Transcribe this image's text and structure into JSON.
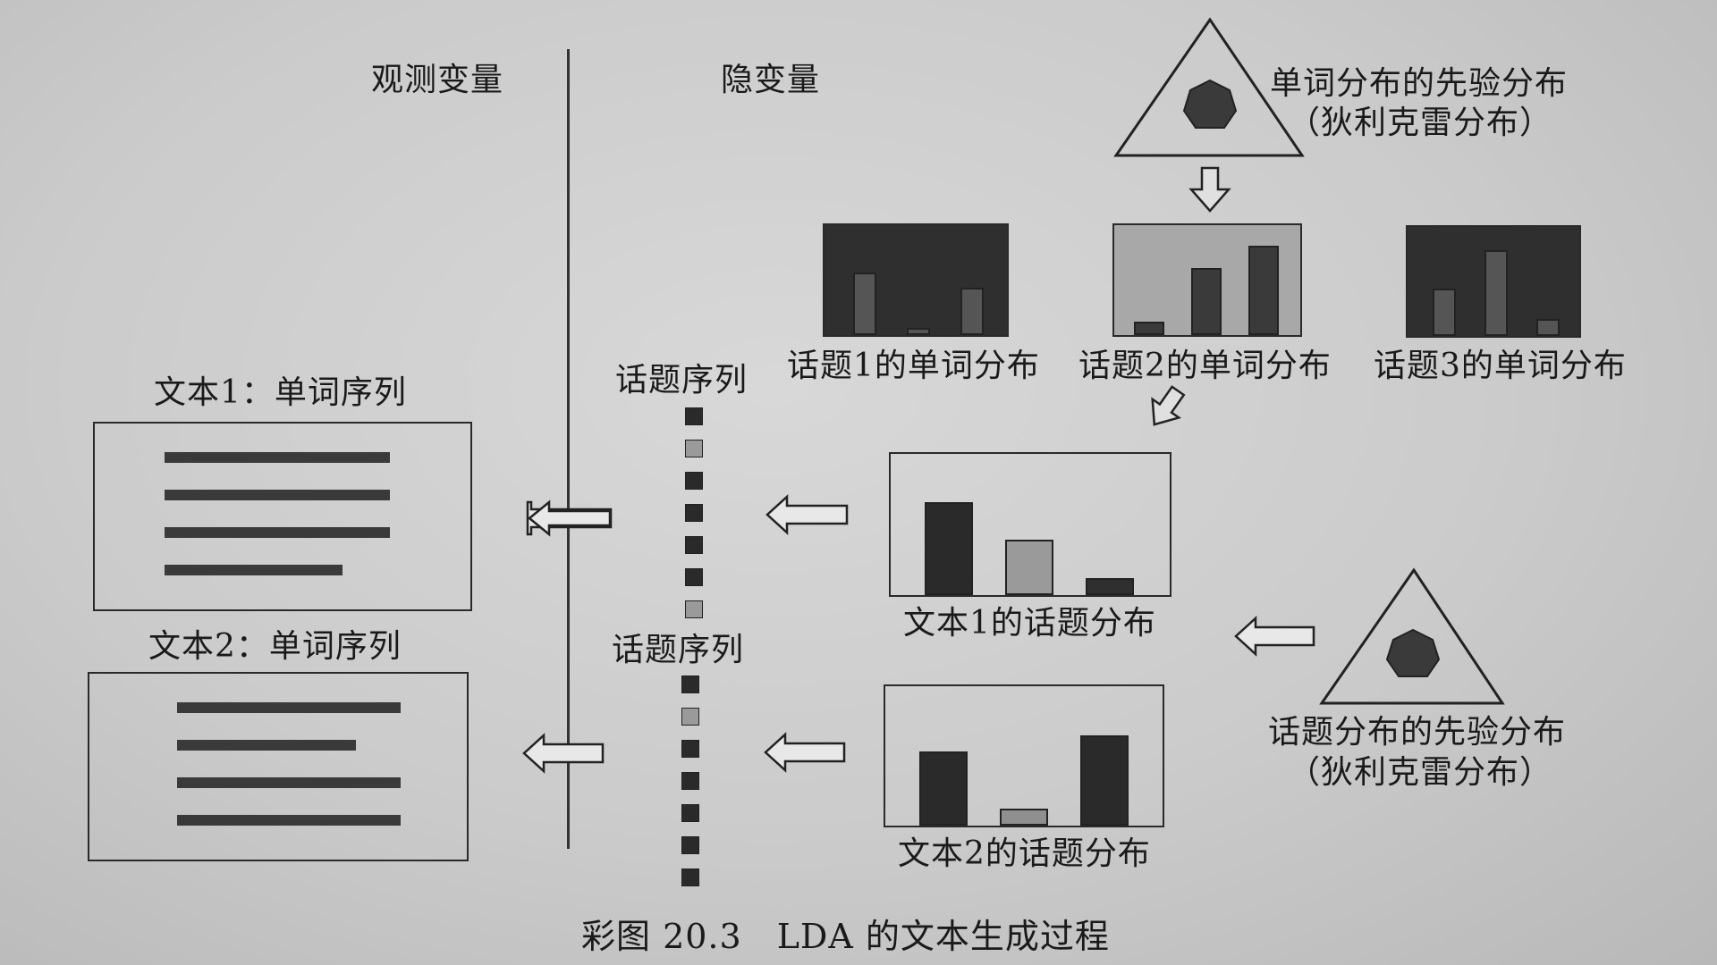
{
  "labels": {
    "observed": "观测变量",
    "latent": "隐变量",
    "word_prior_line1": "单词分布的先验分布",
    "word_prior_line2": "（狄利克雷分布）",
    "topic_prior_line1": "话题分布的先验分布",
    "topic_prior_line2": "（狄利克雷分布）",
    "topic1_words": "话题1的单词分布",
    "topic2_words": "话题2的单词分布",
    "topic3_words": "话题3的单词分布",
    "doc1_sequence": "文本1：单词序列",
    "doc2_sequence": "文本2：单词序列",
    "topic_seq_1": "话题序列",
    "topic_seq_2": "话题序列",
    "doc1_topics": "文本1的话题分布",
    "doc2_topics": "文本2的话题分布",
    "caption": "彩图 20.3　LDA 的文本生成过程"
  },
  "topic_sequence_1": [
    "dark",
    "light",
    "dark",
    "dark",
    "dark",
    "dark",
    "light"
  ],
  "topic_sequence_2": [
    "dark",
    "light",
    "dark",
    "dark",
    "dark",
    "dark",
    "dark"
  ],
  "doc1_lines": [
    1.0,
    1.0,
    1.0,
    0.79
  ],
  "doc2_lines": [
    1.0,
    0.8,
    1.0,
    1.0
  ],
  "topic_word_dists": [
    {
      "bg": "dark",
      "bars": [
        {
          "v": 0.85,
          "c": "#555"
        },
        {
          "v": 0.1,
          "c": "#555"
        },
        {
          "v": 0.65,
          "c": "#555"
        }
      ]
    },
    {
      "bg": "light",
      "bars": [
        {
          "v": 0.15,
          "c": "#3a3a3a"
        },
        {
          "v": 0.75,
          "c": "#3a3a3a"
        },
        {
          "v": 1.0,
          "c": "#3a3a3a"
        }
      ]
    },
    {
      "bg": "dark",
      "bars": [
        {
          "v": 0.55,
          "c": "#555"
        },
        {
          "v": 1.0,
          "c": "#555"
        },
        {
          "v": 0.2,
          "c": "#555"
        }
      ]
    }
  ],
  "doc_topic_dists": [
    {
      "bars": [
        {
          "v": 1.0,
          "c": "#2a2a2a"
        },
        {
          "v": 0.6,
          "c": "#9a9a9a"
        },
        {
          "v": 0.18,
          "c": "#2f2f2f"
        }
      ]
    },
    {
      "bars": [
        {
          "v": 0.78,
          "c": "#2a2a2a"
        },
        {
          "v": 0.18,
          "c": "#8f8f8f"
        },
        {
          "v": 0.95,
          "c": "#2a2a2a"
        }
      ]
    }
  ]
}
